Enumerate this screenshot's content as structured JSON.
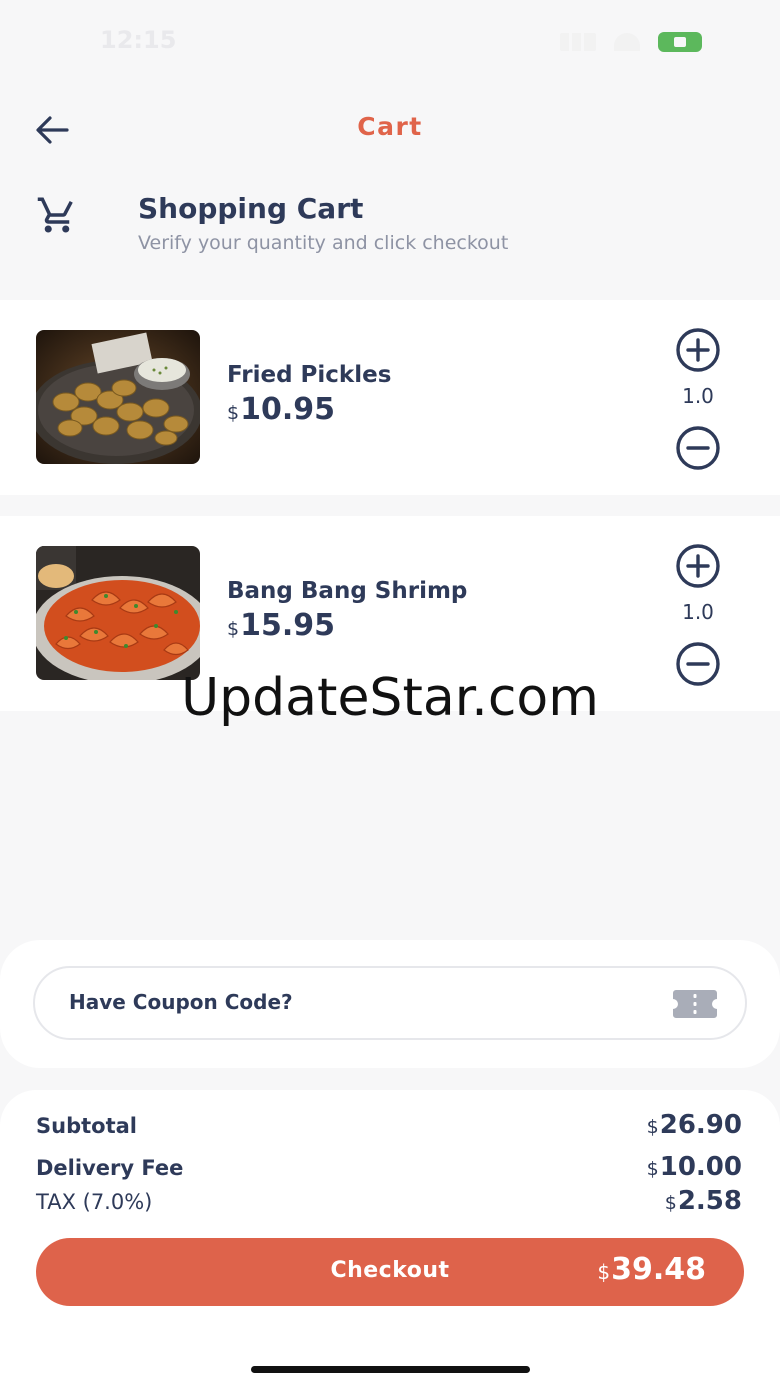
{
  "status_bar": {
    "time": "12:15"
  },
  "header": {
    "title": "Cart"
  },
  "heading": {
    "title": "Shopping Cart",
    "subtitle": "Verify your quantity and click checkout"
  },
  "currency_symbol": "$",
  "items": [
    {
      "name": "Fried Pickles",
      "price": "10.95",
      "quantity": "1.0"
    },
    {
      "name": "Bang Bang Shrimp",
      "price": "15.95",
      "quantity": "1.0"
    }
  ],
  "coupon": {
    "label": "Have Coupon Code?"
  },
  "summary": {
    "subtotal_label": "Subtotal",
    "subtotal_value": "26.90",
    "delivery_label": "Delivery Fee",
    "delivery_value": "10.00",
    "tax_label": "TAX (7.0%)",
    "tax_value": "2.58"
  },
  "checkout": {
    "label": "Checkout",
    "total": "39.48"
  },
  "watermark": "UpdateStar.com",
  "colors": {
    "accent": "#de634b",
    "text": "#2e3a59",
    "muted": "#8e93a4"
  },
  "icons": {
    "back": "arrow-left-icon",
    "cart": "shopping-cart-icon",
    "plus": "plus-circle-icon",
    "minus": "minus-circle-icon",
    "coupon": "ticket-icon"
  }
}
